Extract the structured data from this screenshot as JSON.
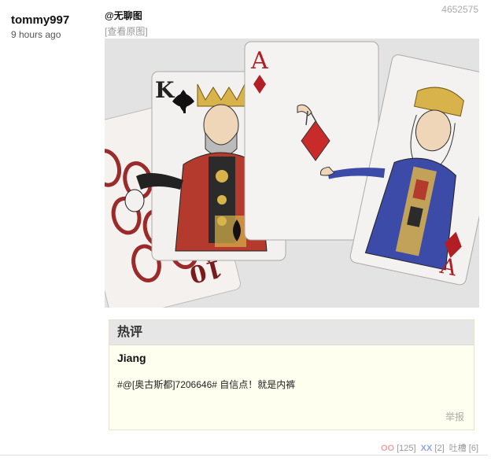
{
  "post": {
    "author": "tommy997",
    "time": "9 hours ago",
    "id": "4652575",
    "tag": "@无聊图",
    "view_original": "[查看原图]"
  },
  "hot_comment": {
    "header": "热评",
    "author": "Jiang",
    "text": "#@[奥古斯都]7206646# 自信点！就是内裤",
    "report": "举报"
  },
  "votes": {
    "oo_label": "OO",
    "oo_count": "[125]",
    "xx_label": "XX",
    "xx_count": "[2]",
    "tucao_label": "吐槽",
    "tucao_count": "[6]"
  },
  "image": {
    "card_king_rank": "K",
    "card_ace_rank": "A",
    "card_queen_rank": "A",
    "card_ten_rank": "10"
  },
  "colors": {
    "oo": "#f3a1a7",
    "xx": "#8fa5e9",
    "hot_bg": "#fffff0",
    "hot_header_bg": "#e6e6e6"
  }
}
